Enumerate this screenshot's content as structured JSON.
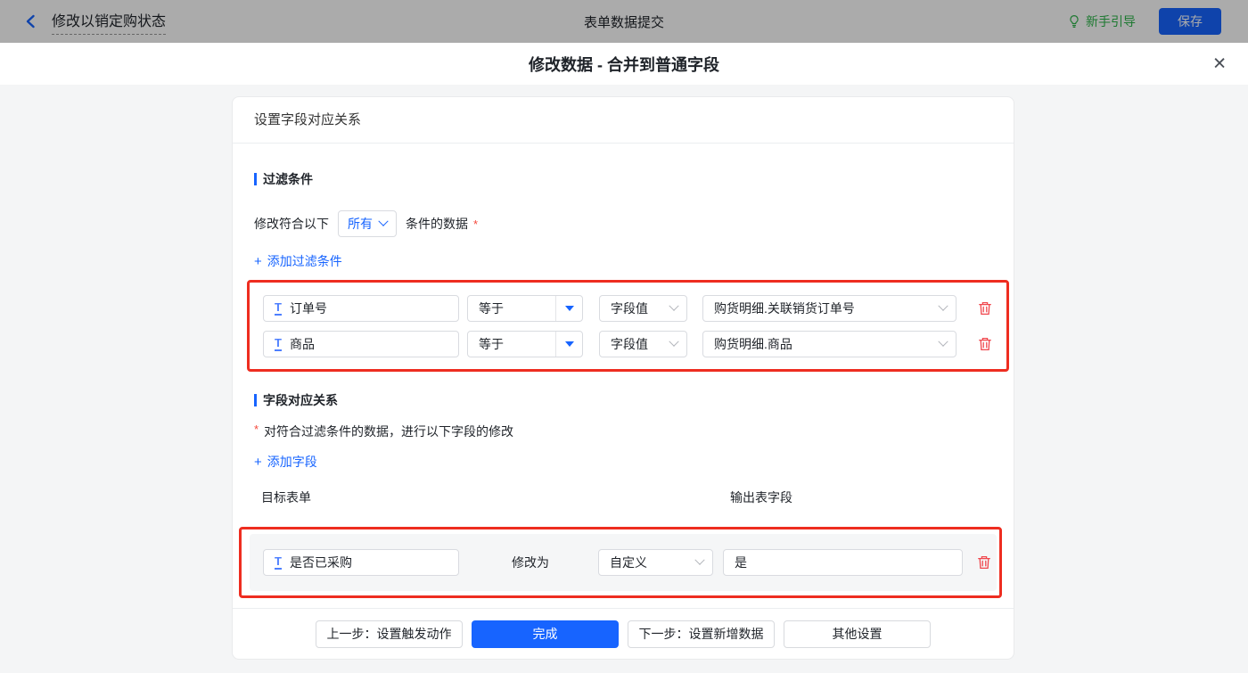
{
  "topbar": {
    "back_title": "修改以销定购状态",
    "center_title": "表单数据提交",
    "guide_label": "新手引导",
    "save_label": "保存"
  },
  "modal": {
    "title": "修改数据 - 合并到普通字段",
    "close_glyph": "✕"
  },
  "panel": {
    "header": "设置字段对应关系",
    "filter_section": {
      "title": "过滤条件",
      "match_prefix": "修改符合以下",
      "match_mode": "所有",
      "match_suffix": "条件的数据",
      "required_mark": "*",
      "plus_glyph": "+",
      "add_label": "添加过滤条件",
      "rows": [
        {
          "field": "订单号",
          "field_type_glyph": "T",
          "operator": "等于",
          "value_type": "字段值",
          "value": "购货明细.关联销货订单号"
        },
        {
          "field": "商品",
          "field_type_glyph": "T",
          "operator": "等于",
          "value_type": "字段值",
          "value": "购货明细.商品"
        }
      ]
    },
    "mapping_section": {
      "title": "字段对应关系",
      "required_mark": "*",
      "desc": "对符合过滤条件的数据，进行以下字段的修改",
      "plus_glyph": "+",
      "add_label": "添加字段",
      "col_target": "目标表单",
      "col_output": "输出表字段",
      "rows": [
        {
          "field": "是否已采购",
          "field_type_glyph": "T",
          "modify_label": "修改为",
          "mode": "自定义",
          "value": "是"
        }
      ]
    },
    "footer": {
      "prev_label": "上一步：设置触发动作",
      "done_label": "完成",
      "next_label": "下一步：设置新增数据",
      "other_label": "其他设置"
    }
  },
  "colors": {
    "accent_blue": "#1764ff",
    "guide_green": "#2db54a",
    "danger_red": "#f0474d",
    "highlight_red": "#ee2d20",
    "page_bg": "#f4f5f6"
  }
}
